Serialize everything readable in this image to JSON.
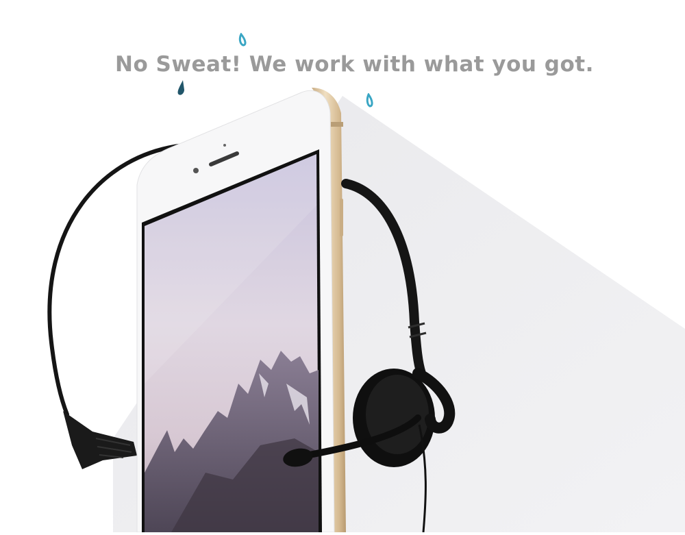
{
  "headline": "No Sweat! We work with what you got.",
  "colors": {
    "background": "#ffffff",
    "shadow": "#eeeef0",
    "headline_text": "#9a9a9a",
    "drop_dark": "#21566a",
    "drop_light": "#3aa6c4",
    "phone_gold": "#dcc6a3",
    "headset_black": "#151515"
  },
  "icons": [
    "sweat-drop-icon",
    "sweat-drop-icon",
    "sweat-drop-icon"
  ]
}
